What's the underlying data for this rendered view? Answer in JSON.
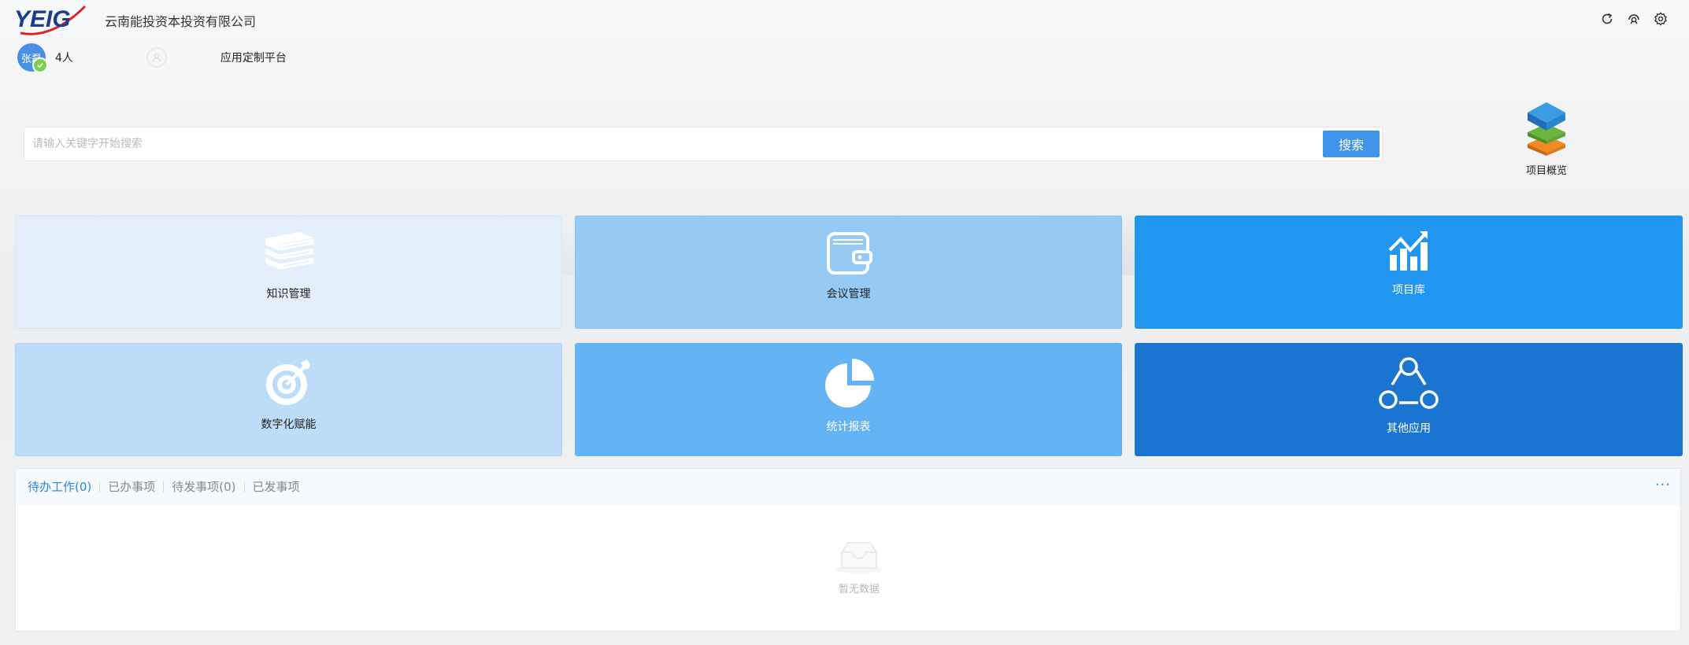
{
  "header": {
    "logo_text": "YEIG",
    "company": "云南能投资本投资有限公司",
    "icons": [
      "refresh-icon",
      "support-icon",
      "settings-icon"
    ]
  },
  "user": {
    "avatar_text": "张磊",
    "count": "4人",
    "platform": "应用定制平台"
  },
  "search": {
    "placeholder": "请输入关键字开始搜索",
    "button": "搜索"
  },
  "overview": {
    "label": "项目概览"
  },
  "tiles": [
    {
      "label": "知识管理",
      "icon": "books-icon",
      "bg": "#e3f0fc",
      "text_color": "#222222"
    },
    {
      "label": "会议管理",
      "icon": "wallet-icon",
      "bg": "#95caf5",
      "text_color": "#222222"
    },
    {
      "label": "项目库",
      "icon": "chart-icon",
      "bg": "#2196f0",
      "text_color": "#ffffff"
    },
    {
      "label": "数字化赋能",
      "icon": "target-icon",
      "bg": "#bcdcf7",
      "text_color": "#222222"
    },
    {
      "label": "统计报表",
      "icon": "pie-icon",
      "bg": "#64b3f4",
      "text_color": "#ffffff"
    },
    {
      "label": "其他应用",
      "icon": "share-icon",
      "bg": "#1a74d2",
      "text_color": "#ffffff"
    }
  ],
  "tasks": {
    "tabs": [
      "待办工作(0)",
      "已办事项",
      "待发事项(0)",
      "已发事项"
    ],
    "active_tab": "待办工作(0)",
    "more": "···",
    "empty_text": "暂无数据"
  },
  "colors": {
    "accent": "#3f93e8",
    "active_tab": "#2e86de"
  }
}
